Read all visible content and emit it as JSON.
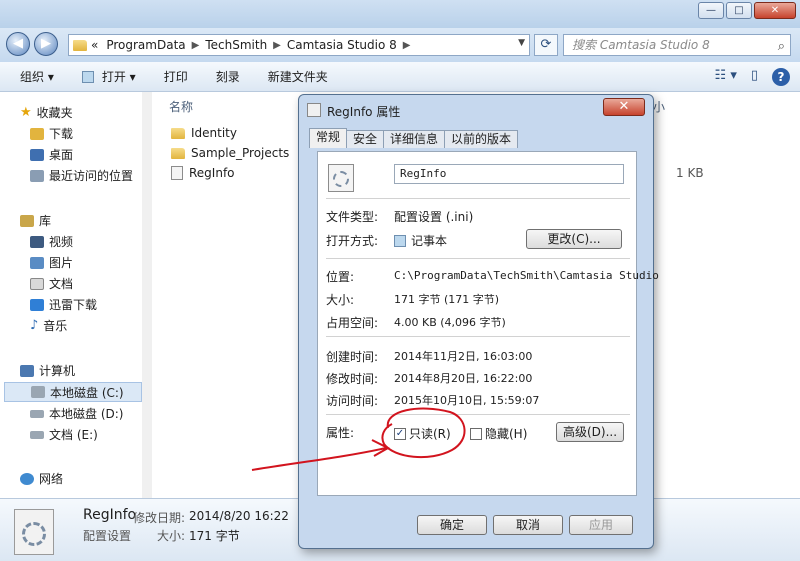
{
  "window": {
    "controls": {
      "minimize": "—",
      "maximize": "□",
      "close": "✕"
    }
  },
  "nav": {
    "back": "◀",
    "forward": "▶",
    "breadcrumb": [
      "ProgramData",
      "TechSmith",
      "Camtasia Studio 8"
    ],
    "breadcrumb_prefix": "«",
    "search_placeholder": "搜索 Camtasia Studio 8"
  },
  "toolbar": {
    "organize": "组织 ▾",
    "open": "打开 ▾",
    "print": "打印",
    "burn": "刻录",
    "new_folder": "新建文件夹"
  },
  "sidebar": {
    "favorites": "收藏夹",
    "downloads": "下载",
    "desktop": "桌面",
    "recent": "最近访问的位置",
    "libraries": "库",
    "videos": "视频",
    "pictures": "图片",
    "documents": "文档",
    "xunlei": "迅雷下载",
    "music": "音乐",
    "computer": "计算机",
    "drive_c": "本地磁盘 (C:)",
    "drive_d": "本地磁盘 (D:)",
    "drive_e": "文档 (E:)",
    "network": "网络"
  },
  "files": {
    "col_name": "名称",
    "col_size_tail": "小",
    "items": [
      "Identity",
      "Sample_Projects",
      "RegInfo"
    ],
    "reginfo_size": "1 KB"
  },
  "details": {
    "name": "RegInfo",
    "type": "配置设置",
    "modified_label": "修改日期:",
    "modified_value": "2014/8/20 16:22",
    "size_label": "大小:",
    "size_value": "171 字节"
  },
  "dialog": {
    "title": "RegInfo 属性",
    "close": "✕",
    "tabs": [
      "常规",
      "安全",
      "详细信息",
      "以前的版本"
    ],
    "filename": "RegInfo",
    "type_label": "文件类型:",
    "type_value": "配置设置 (.ini)",
    "opens_label": "打开方式:",
    "opens_value": "记事本",
    "change_btn": "更改(C)...",
    "location_label": "位置:",
    "location_value": "C:\\ProgramData\\TechSmith\\Camtasia Studio",
    "size_label": "大小:",
    "size_value": "171 字节 (171 字节)",
    "disk_label": "占用空间:",
    "disk_value": "4.00 KB (4,096 字节)",
    "created_label": "创建时间:",
    "created_value": "2014年11月2日, 16:03:00",
    "modified_label": "修改时间:",
    "modified_value": "2014年8月20日, 16:22:00",
    "accessed_label": "访问时间:",
    "accessed_value": "2015年10月10日, 15:59:07",
    "attr_label": "属性:",
    "readonly": "只读(R)",
    "hidden": "隐藏(H)",
    "advanced_btn": "高级(D)...",
    "ok_btn": "确定",
    "cancel_btn": "取消",
    "apply_btn": "应用",
    "readonly_checked": "✓"
  },
  "annotation_color": "#d2141e"
}
